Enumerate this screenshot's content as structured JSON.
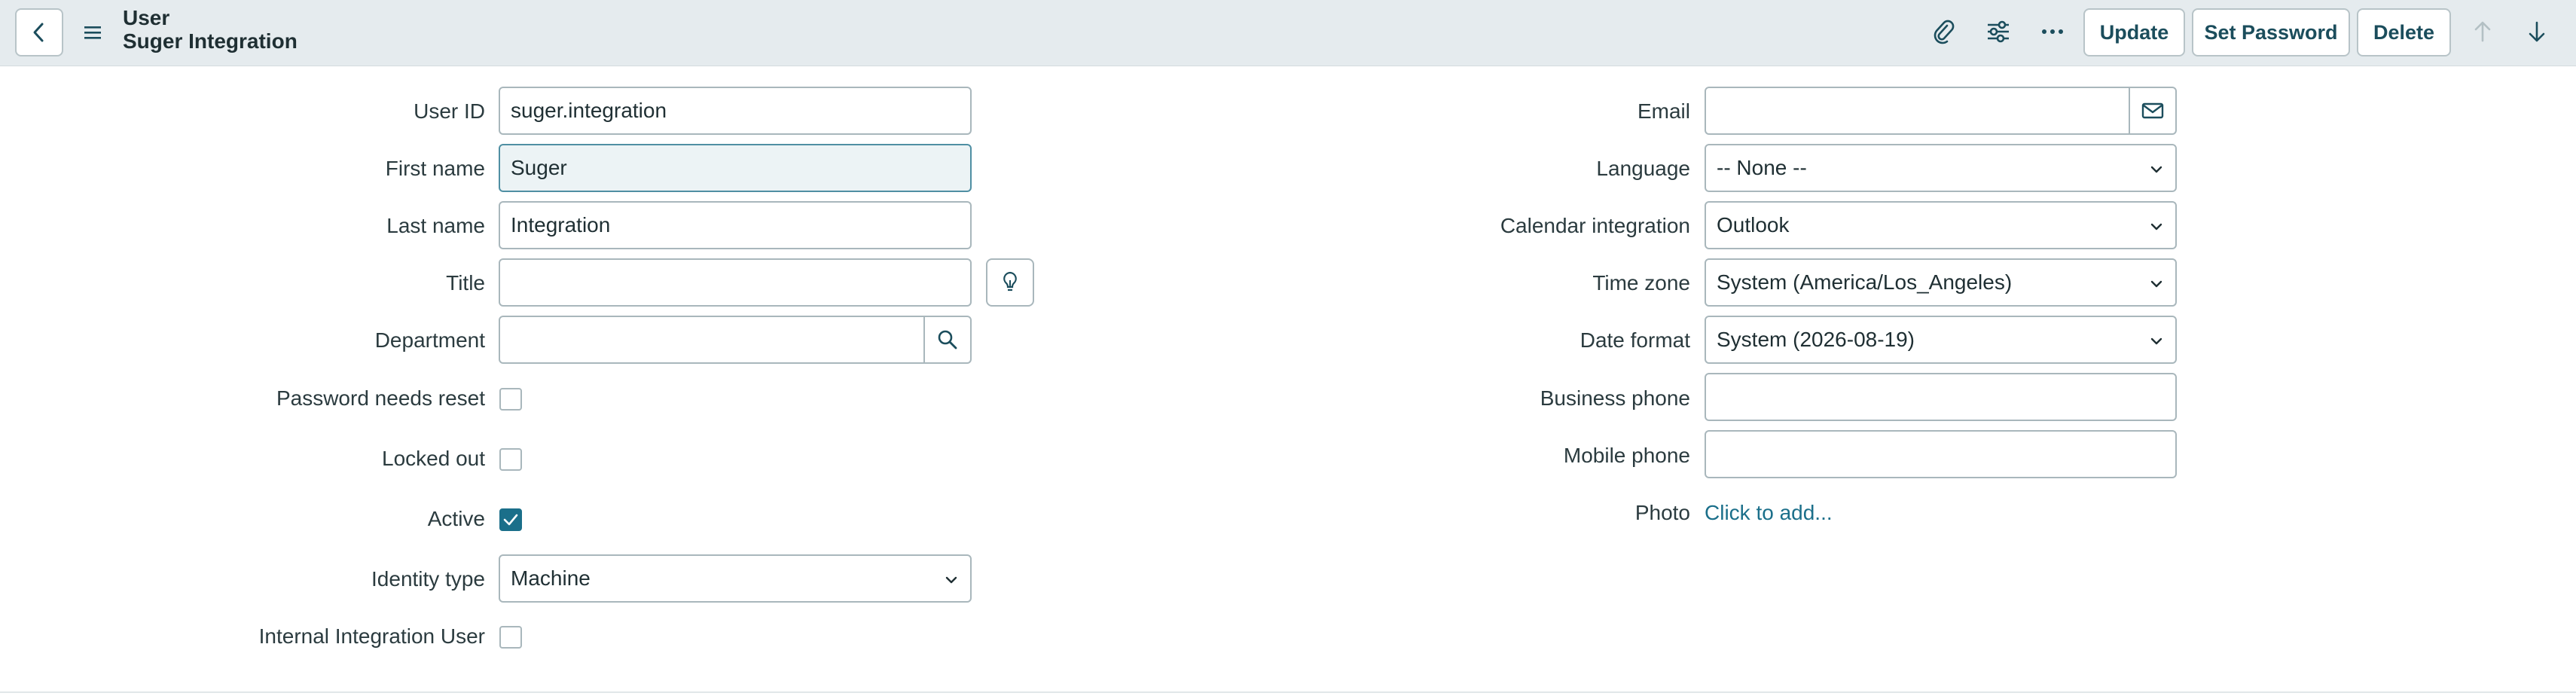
{
  "header": {
    "record_type": "User",
    "record_name": "Suger Integration",
    "buttons": {
      "update": "Update",
      "set_password": "Set Password",
      "delete": "Delete"
    },
    "icons": [
      "back-icon",
      "menu-icon",
      "paperclip-icon",
      "sliders-icon",
      "more-icon",
      "arrow-up-icon",
      "arrow-down-icon"
    ]
  },
  "left_fields": {
    "user_id": {
      "label": "User ID",
      "value": "suger.integration"
    },
    "first_name": {
      "label": "First name",
      "value": "Suger"
    },
    "last_name": {
      "label": "Last name",
      "value": "Integration"
    },
    "title": {
      "label": "Title",
      "value": ""
    },
    "department": {
      "label": "Department",
      "value": ""
    },
    "password_needs_reset": {
      "label": "Password needs reset",
      "checked": false
    },
    "locked_out": {
      "label": "Locked out",
      "checked": false
    },
    "active": {
      "label": "Active",
      "checked": true
    },
    "identity_type": {
      "label": "Identity type",
      "value": "Machine"
    },
    "internal_integration_user": {
      "label": "Internal Integration User",
      "checked": false
    }
  },
  "right_fields": {
    "email": {
      "label": "Email",
      "value": ""
    },
    "language": {
      "label": "Language",
      "value": "-- None --"
    },
    "calendar_integration": {
      "label": "Calendar integration",
      "value": "Outlook"
    },
    "time_zone": {
      "label": "Time zone",
      "value": "System (America/Los_Angeles)"
    },
    "date_format": {
      "label": "Date format",
      "value": "System (2026-08-19)"
    },
    "business_phone": {
      "label": "Business phone",
      "value": ""
    },
    "mobile_phone": {
      "label": "Mobile phone",
      "value": ""
    },
    "photo": {
      "label": "Photo",
      "link": "Click to add..."
    }
  },
  "colors": {
    "header_bg": "#e5ebee",
    "accent": "#1b6f8a",
    "button_text": "#1b4d5c"
  }
}
